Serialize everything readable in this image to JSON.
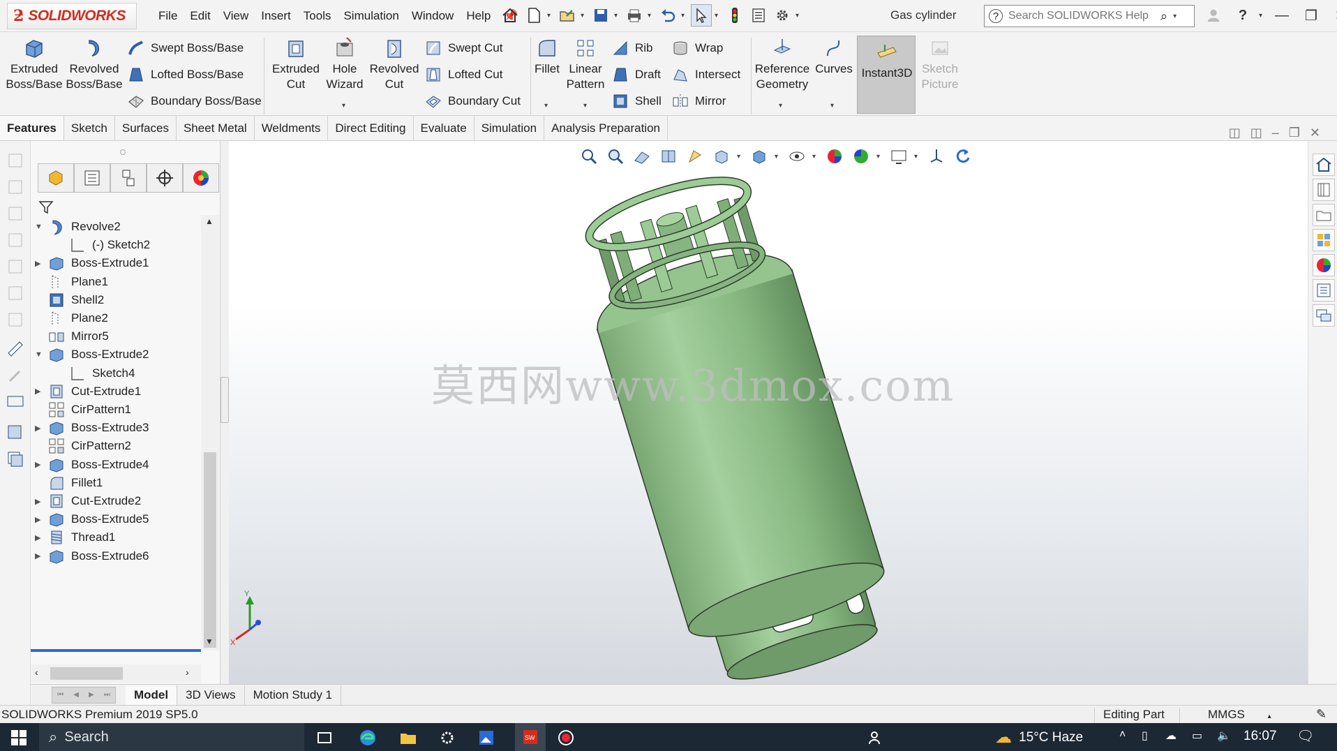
{
  "app": {
    "logo_text": "SOLIDWORKS",
    "document_title": "Gas cylinder",
    "search_placeholder": "Search SOLIDWORKS Help"
  },
  "menu": [
    "File",
    "Edit",
    "View",
    "Insert",
    "Tools",
    "Simulation",
    "Window",
    "Help"
  ],
  "commands": {
    "extruded_boss": "Extruded\nBoss/Base",
    "revolved_boss": "Revolved\nBoss/Base",
    "swept_boss": "Swept Boss/Base",
    "lofted_boss": "Lofted Boss/Base",
    "boundary_boss": "Boundary Boss/Base",
    "extruded_cut": "Extruded\nCut",
    "hole_wizard": "Hole\nWizard",
    "revolved_cut": "Revolved\nCut",
    "swept_cut": "Swept Cut",
    "lofted_cut": "Lofted Cut",
    "boundary_cut": "Boundary Cut",
    "fillet": "Fillet",
    "linear_pattern": "Linear\nPattern",
    "rib": "Rib",
    "draft": "Draft",
    "shell": "Shell",
    "wrap": "Wrap",
    "intersect": "Intersect",
    "mirror": "Mirror",
    "reference_geometry": "Reference\nGeometry",
    "curves": "Curves",
    "instant3d": "Instant3D",
    "sketch_picture": "Sketch\nPicture"
  },
  "tabs": [
    "Features",
    "Sketch",
    "Surfaces",
    "Sheet Metal",
    "Weldments",
    "Direct Editing",
    "Evaluate",
    "Simulation",
    "Analysis Preparation"
  ],
  "active_tab": "Features",
  "tree": [
    {
      "label": "Revolve2",
      "icon": "revolve-icon",
      "expander": "down",
      "indent": 0
    },
    {
      "label": "(-) Sketch2",
      "icon": "sketch-icon",
      "expander": "",
      "indent": 1
    },
    {
      "label": "Boss-Extrude1",
      "icon": "extrude-icon",
      "expander": "right",
      "indent": 0
    },
    {
      "label": "Plane1",
      "icon": "plane-icon",
      "expander": "",
      "indent": 0
    },
    {
      "label": "Shell2",
      "icon": "shell-icon",
      "expander": "",
      "indent": 0
    },
    {
      "label": "Plane2",
      "icon": "plane-icon",
      "expander": "",
      "indent": 0
    },
    {
      "label": "Mirror5",
      "icon": "mirror-icon",
      "expander": "",
      "indent": 0
    },
    {
      "label": "Boss-Extrude2",
      "icon": "extrude-icon",
      "expander": "down",
      "indent": 0
    },
    {
      "label": "Sketch4",
      "icon": "sketch-icon",
      "expander": "",
      "indent": 1
    },
    {
      "label": "Cut-Extrude1",
      "icon": "cut-icon",
      "expander": "right",
      "indent": 0
    },
    {
      "label": "CirPattern1",
      "icon": "pattern-icon",
      "expander": "",
      "indent": 0
    },
    {
      "label": "Boss-Extrude3",
      "icon": "extrude-icon",
      "expander": "right",
      "indent": 0
    },
    {
      "label": "CirPattern2",
      "icon": "pattern-icon",
      "expander": "",
      "indent": 0
    },
    {
      "label": "Boss-Extrude4",
      "icon": "extrude-icon",
      "expander": "right",
      "indent": 0
    },
    {
      "label": "Fillet1",
      "icon": "fillet-icon",
      "expander": "",
      "indent": 0
    },
    {
      "label": "Cut-Extrude2",
      "icon": "cut-icon",
      "expander": "right",
      "indent": 0
    },
    {
      "label": "Boss-Extrude5",
      "icon": "extrude-icon",
      "expander": "right",
      "indent": 0
    },
    {
      "label": "Thread1",
      "icon": "thread-icon",
      "expander": "right",
      "indent": 0
    },
    {
      "label": "Boss-Extrude6",
      "icon": "extrude-icon",
      "expander": "right",
      "indent": 0
    }
  ],
  "viewport": {
    "watermark": "莫西网www.3dmox.com",
    "model_color": "#8fbf8a",
    "triad_y": "Y",
    "triad_x": "X"
  },
  "bottom_tabs": [
    "Model",
    "3D Views",
    "Motion Study 1"
  ],
  "active_bottom_tab": "Model",
  "status": {
    "product": "SOLIDWORKS Premium 2019 SP5.0",
    "mode": "Editing Part",
    "units": "MMGS"
  },
  "taskbar": {
    "search_label": "Search",
    "weather": "15°C  Haze",
    "time": "16:07"
  },
  "colors": {
    "brand": "#d52b1e",
    "taskbar": "#1c2833",
    "model": "#8fbf8a"
  }
}
